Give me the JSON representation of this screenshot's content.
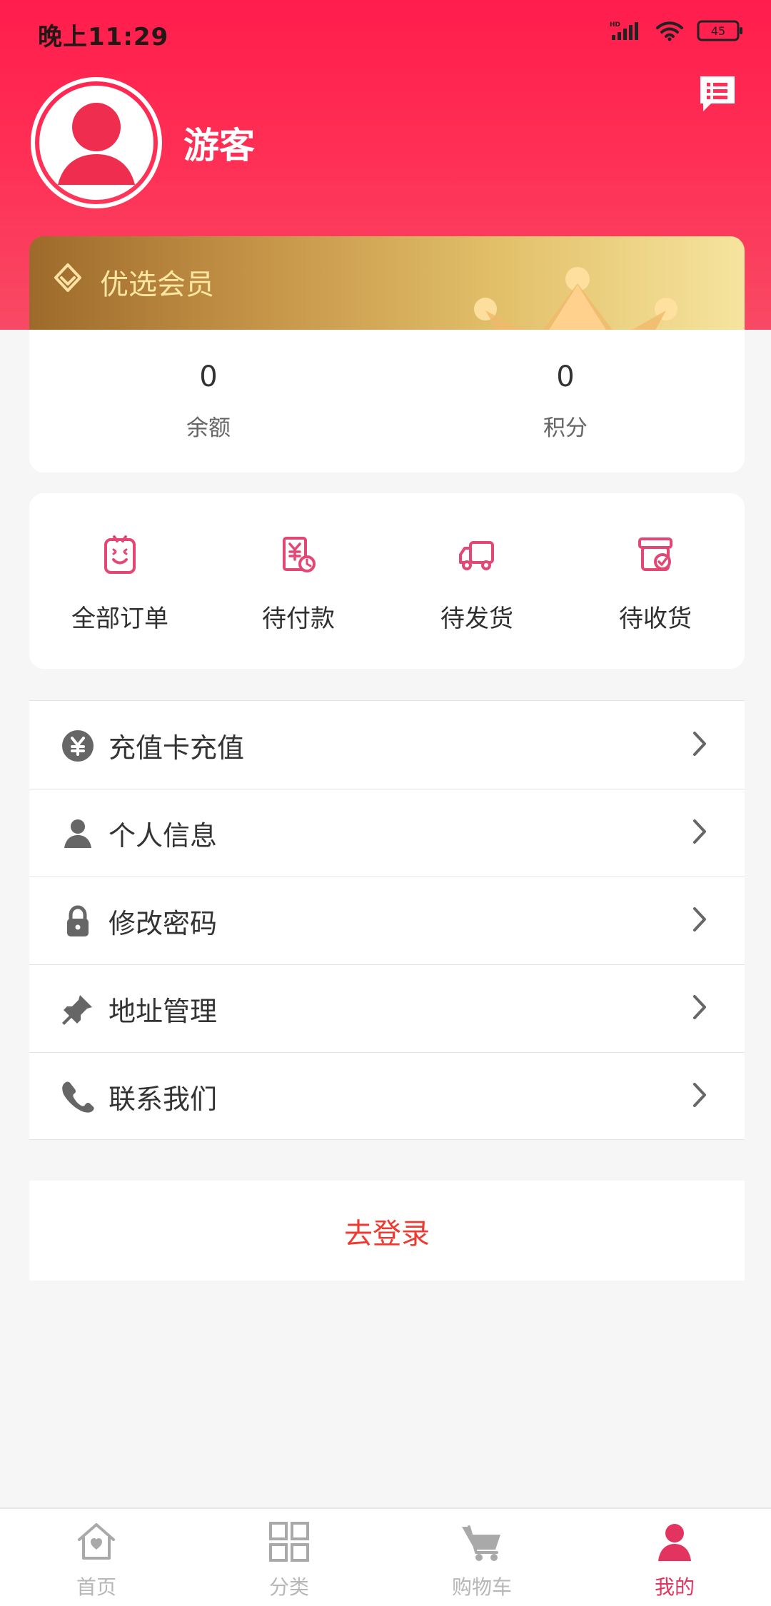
{
  "status_bar": {
    "time": "晚上11:29",
    "network_badge": "HD",
    "battery_level": "45"
  },
  "profile": {
    "username": "游客"
  },
  "vip": {
    "label": "优选会员"
  },
  "balances": [
    {
      "value": "0",
      "label": "余额"
    },
    {
      "value": "0",
      "label": "积分"
    }
  ],
  "orders": [
    {
      "label": "全部订单"
    },
    {
      "label": "待付款"
    },
    {
      "label": "待发货"
    },
    {
      "label": "待收货"
    }
  ],
  "menu": [
    {
      "label": "充值卡充值",
      "icon": "yen-coin-icon"
    },
    {
      "label": "个人信息",
      "icon": "person-icon"
    },
    {
      "label": "修改密码",
      "icon": "lock-icon"
    },
    {
      "label": "地址管理",
      "icon": "pin-icon"
    },
    {
      "label": "联系我们",
      "icon": "phone-icon"
    }
  ],
  "login": {
    "label": "去登录"
  },
  "tabbar": {
    "items": [
      {
        "label": "首页",
        "icon": "home-heart-icon",
        "active": false
      },
      {
        "label": "分类",
        "icon": "grid-icon",
        "active": false
      },
      {
        "label": "购物车",
        "icon": "cart-icon",
        "active": false
      },
      {
        "label": "我的",
        "icon": "profile-icon",
        "active": true
      }
    ]
  },
  "colors": {
    "header_red": "#ff1d4d",
    "accent_red": "#ef3a32",
    "tab_active": "#e3345f",
    "icon_gray": "#666666",
    "order_icon_pink": "#e34875",
    "vip_gold": "#c69548"
  }
}
